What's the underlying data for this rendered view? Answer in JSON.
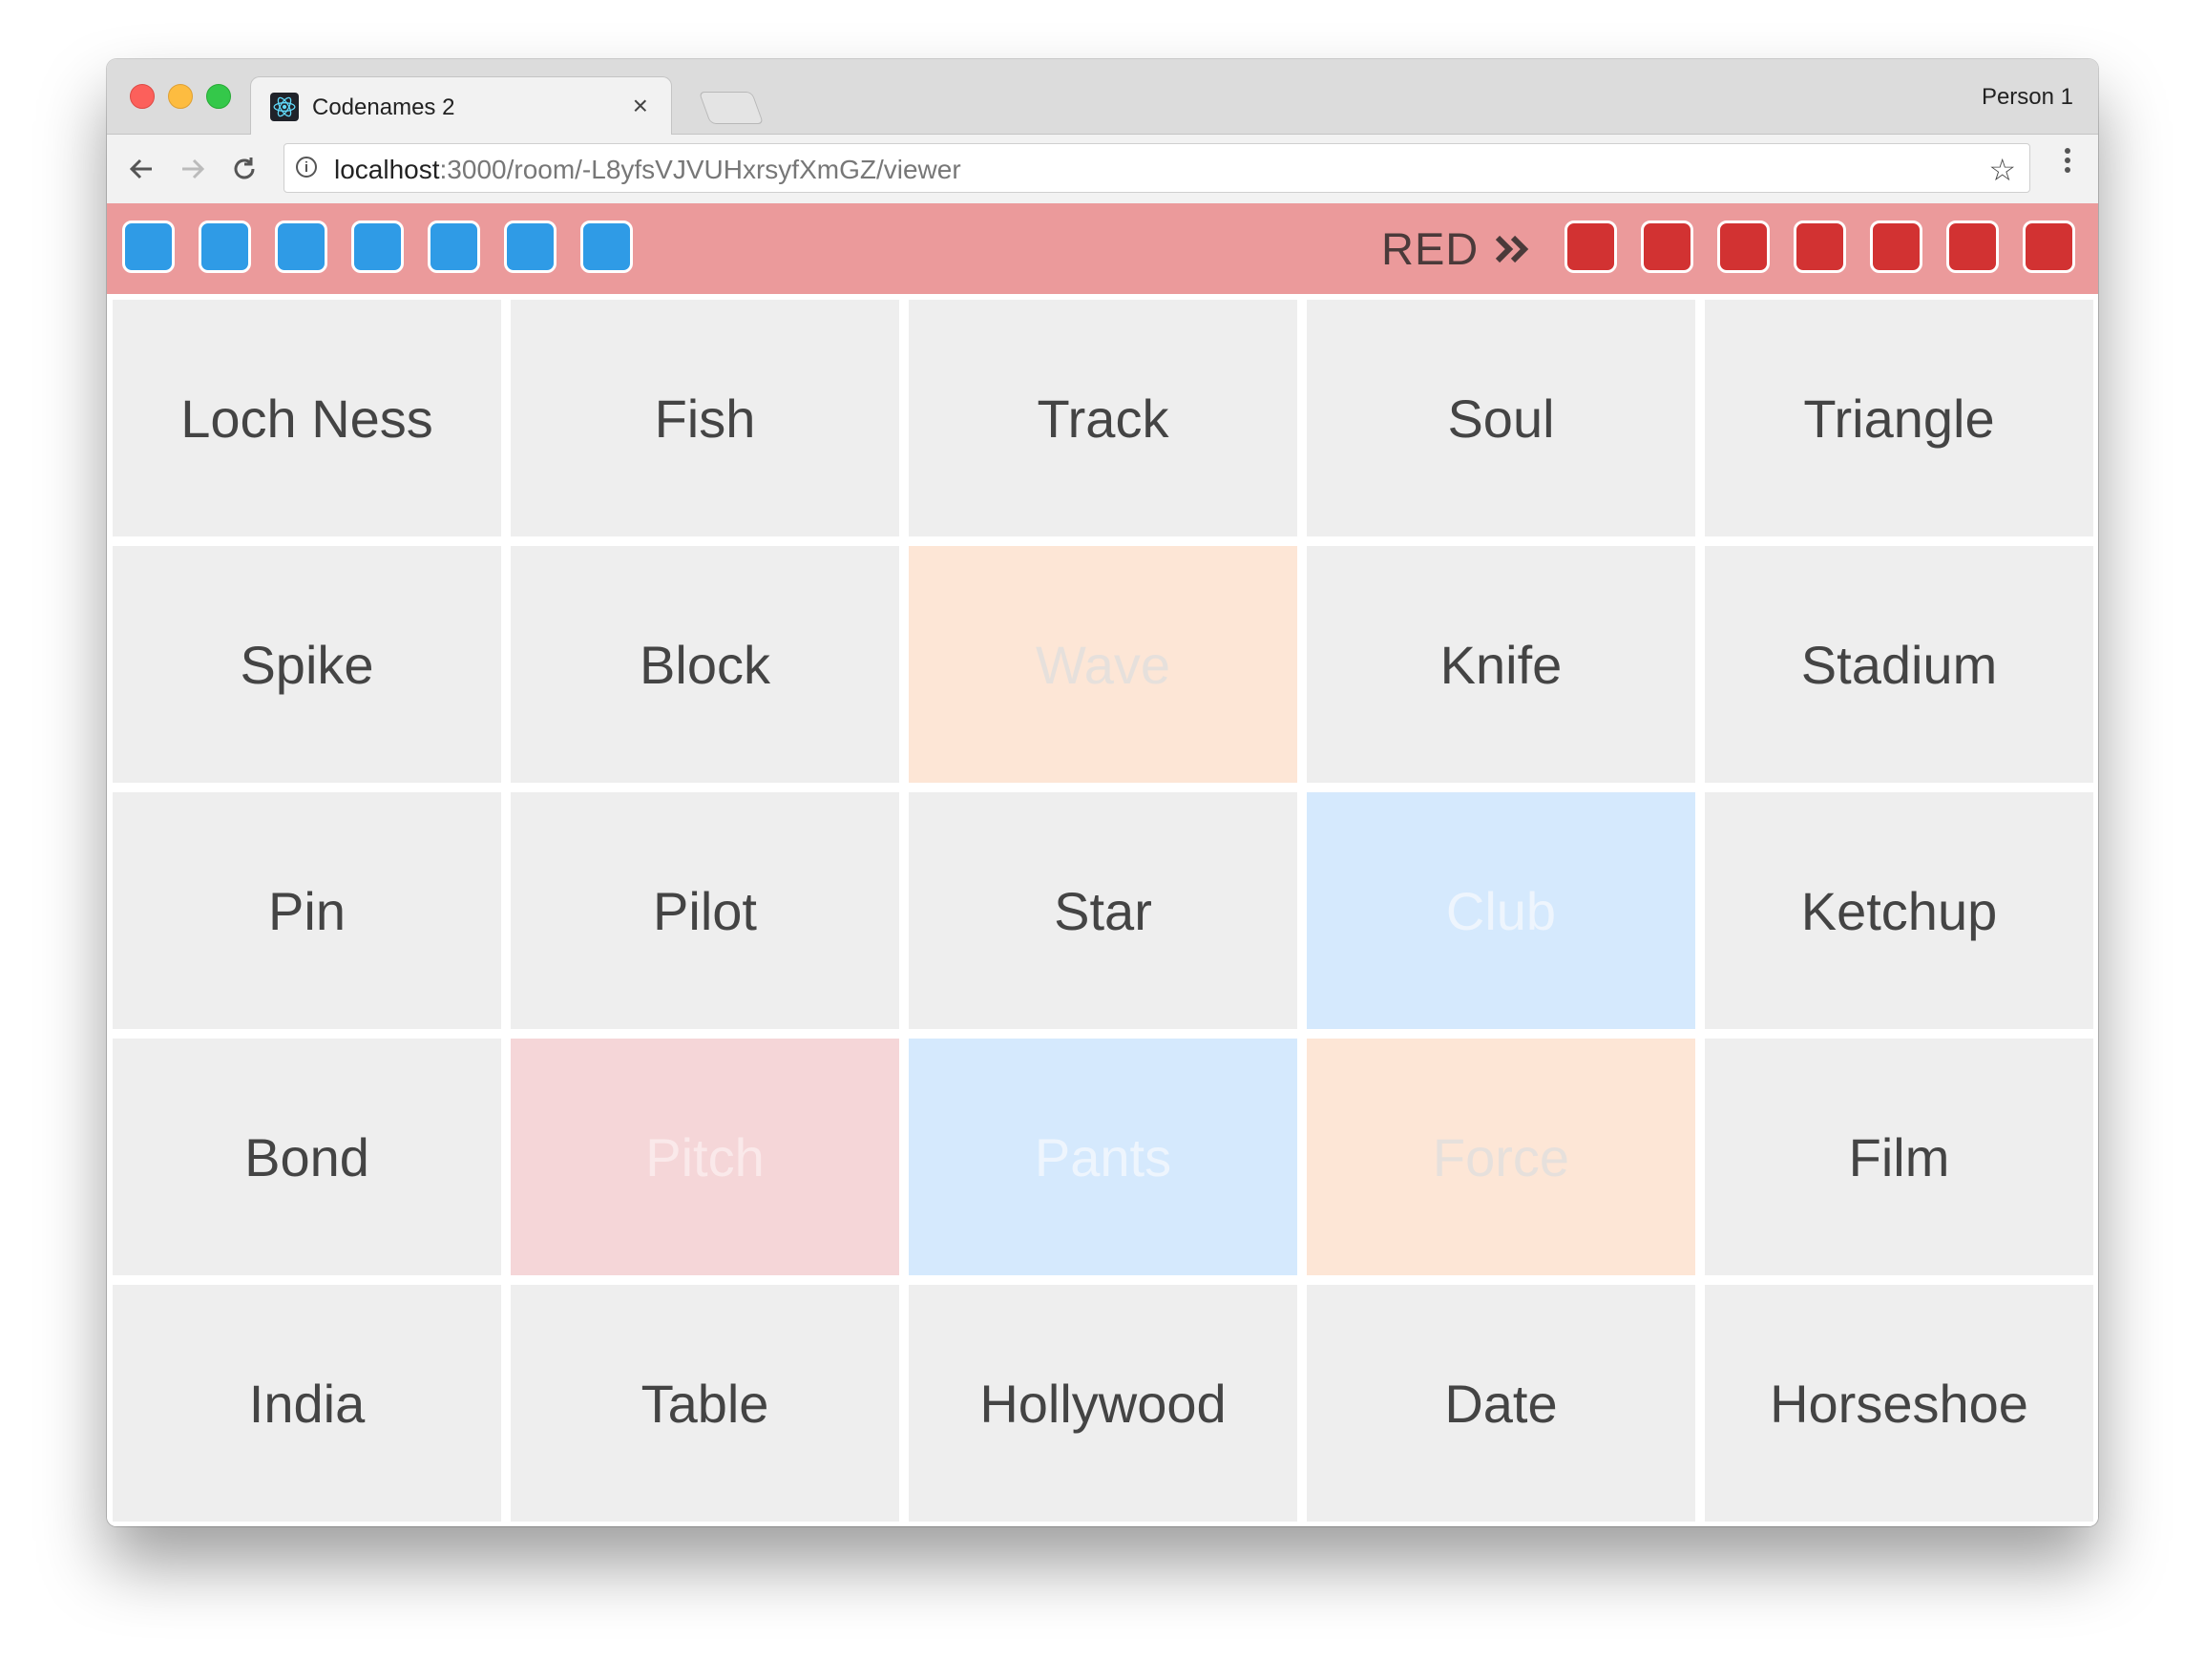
{
  "browser": {
    "tab_title": "Codenames 2",
    "tab_close": "×",
    "profile": "Person 1",
    "url_host": "localhost",
    "url_rest": ":3000/room/-L8yfsVJVUHxrsyfXmGZ/viewer"
  },
  "scoreboard": {
    "blue_remaining": 7,
    "red_remaining": 7,
    "turn_label": "RED",
    "colors": {
      "bar": "#eb9a9b",
      "blue": "#2f9be6",
      "red": "#d23232"
    }
  },
  "board": {
    "cards": [
      {
        "word": "Loch Ness",
        "state": "unrevealed"
      },
      {
        "word": "Fish",
        "state": "unrevealed"
      },
      {
        "word": "Track",
        "state": "unrevealed"
      },
      {
        "word": "Soul",
        "state": "unrevealed"
      },
      {
        "word": "Triangle",
        "state": "unrevealed"
      },
      {
        "word": "Spike",
        "state": "unrevealed"
      },
      {
        "word": "Block",
        "state": "unrevealed"
      },
      {
        "word": "Wave",
        "state": "revealed-neutral"
      },
      {
        "word": "Knife",
        "state": "unrevealed"
      },
      {
        "word": "Stadium",
        "state": "unrevealed"
      },
      {
        "word": "Pin",
        "state": "unrevealed"
      },
      {
        "word": "Pilot",
        "state": "unrevealed"
      },
      {
        "word": "Star",
        "state": "unrevealed"
      },
      {
        "word": "Club",
        "state": "revealed-blue"
      },
      {
        "word": "Ketchup",
        "state": "unrevealed"
      },
      {
        "word": "Bond",
        "state": "unrevealed"
      },
      {
        "word": "Pitch",
        "state": "revealed-red"
      },
      {
        "word": "Pants",
        "state": "revealed-blue"
      },
      {
        "word": "Force",
        "state": "revealed-neutral"
      },
      {
        "word": "Film",
        "state": "unrevealed"
      },
      {
        "word": "India",
        "state": "unrevealed"
      },
      {
        "word": "Table",
        "state": "unrevealed"
      },
      {
        "word": "Hollywood",
        "state": "unrevealed"
      },
      {
        "word": "Date",
        "state": "unrevealed"
      },
      {
        "word": "Horseshoe",
        "state": "unrevealed"
      }
    ]
  }
}
